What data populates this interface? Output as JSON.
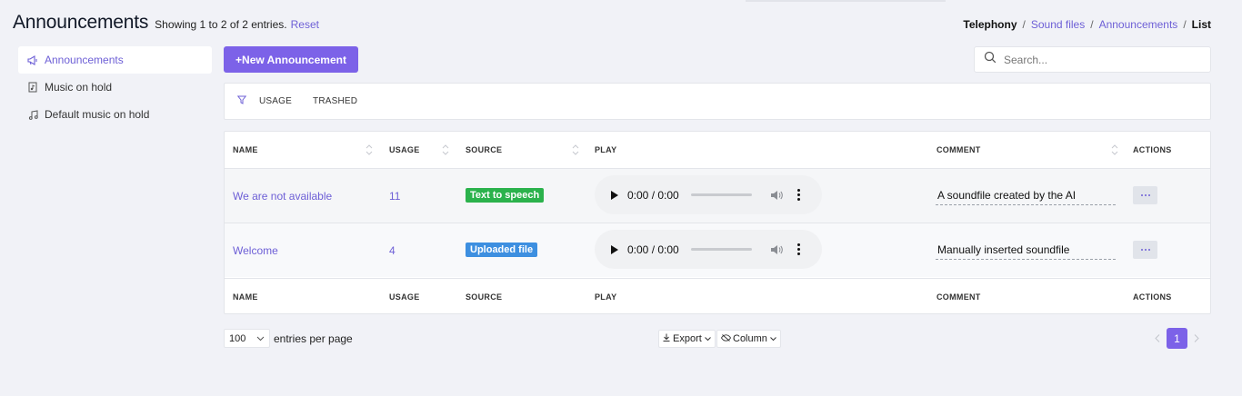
{
  "header": {
    "title": "Announcements",
    "showing": "Showing 1 to 2 of 2 entries.",
    "reset": "Reset"
  },
  "breadcrumb": {
    "root": "Telephony",
    "sep": "/",
    "sound_files": "Sound files",
    "announcements": "Announcements",
    "current": "List"
  },
  "sidebar": {
    "items": [
      {
        "label": "Announcements",
        "icon": "megaphone-icon",
        "active": true
      },
      {
        "label": "Music on hold",
        "icon": "file-music-icon",
        "active": false
      },
      {
        "label": "Default music on hold",
        "icon": "music-note-icon",
        "active": false
      }
    ]
  },
  "toolbar": {
    "new_button": "+New Announcement",
    "search_placeholder": "Search..."
  },
  "filters": {
    "usage": "USAGE",
    "trashed": "TRASHED"
  },
  "table": {
    "columns": {
      "name": "NAME",
      "usage": "USAGE",
      "source": "SOURCE",
      "play": "PLAY",
      "comment": "COMMENT",
      "actions": "ACTIONS"
    },
    "rows": [
      {
        "name": "We are not available",
        "usage": "11",
        "source": "Text to speech",
        "source_color": "#2bb24c",
        "time": "0:00 / 0:00",
        "comment": "A soundfile created by the AI"
      },
      {
        "name": "Welcome",
        "usage": "4",
        "source": "Uploaded file",
        "source_color": "#3d8fe0",
        "time": "0:00 / 0:00",
        "comment": "Manually inserted soundfile"
      }
    ]
  },
  "footer": {
    "per_page_value": "100",
    "per_page_label": "entries per page",
    "export": "Export",
    "column": "Column",
    "current_page": "1"
  },
  "colors": {
    "accent": "#7c62e8",
    "link": "#6d5fd6",
    "background": "#f1f2f7"
  }
}
